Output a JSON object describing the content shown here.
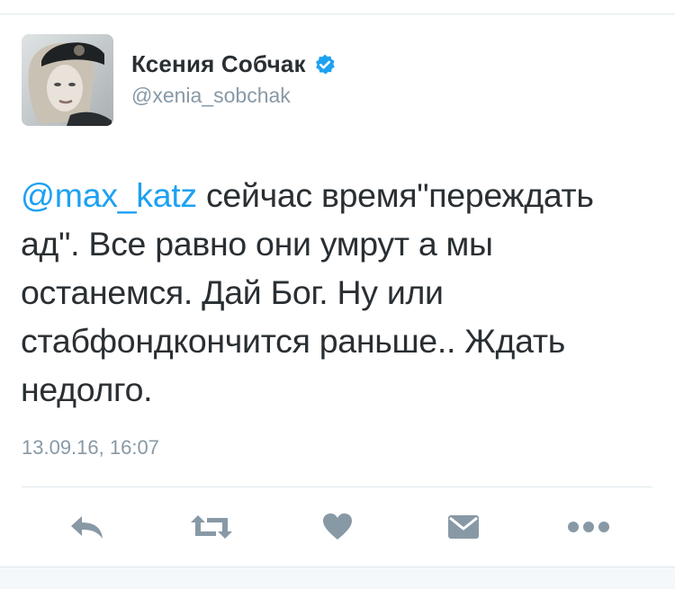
{
  "author": {
    "display_name": "Ксения Собчак",
    "handle": "@xenia_sobchak",
    "verified": true,
    "avatar_icon": "profile-photo"
  },
  "tweet": {
    "mention": "@max_katz",
    "text": " сейчас время\"переждать ад\". Все равно они умрут а мы останемся. Дай Бог. Ну или стабфондкончится раньше.. Ждать недолго.",
    "timestamp": "13.09.16, 16:07"
  },
  "actions": [
    {
      "icon": "reply-icon"
    },
    {
      "icon": "retweet-icon"
    },
    {
      "icon": "heart-icon"
    },
    {
      "icon": "direct-message-icon"
    },
    {
      "icon": "more-icon"
    }
  ],
  "colors": {
    "link": "#1da1f2",
    "text": "#292f33",
    "secondary": "#8899a6",
    "icon": "#8899a6",
    "verified": "#1da1f2",
    "divider": "#e1e8ed"
  }
}
